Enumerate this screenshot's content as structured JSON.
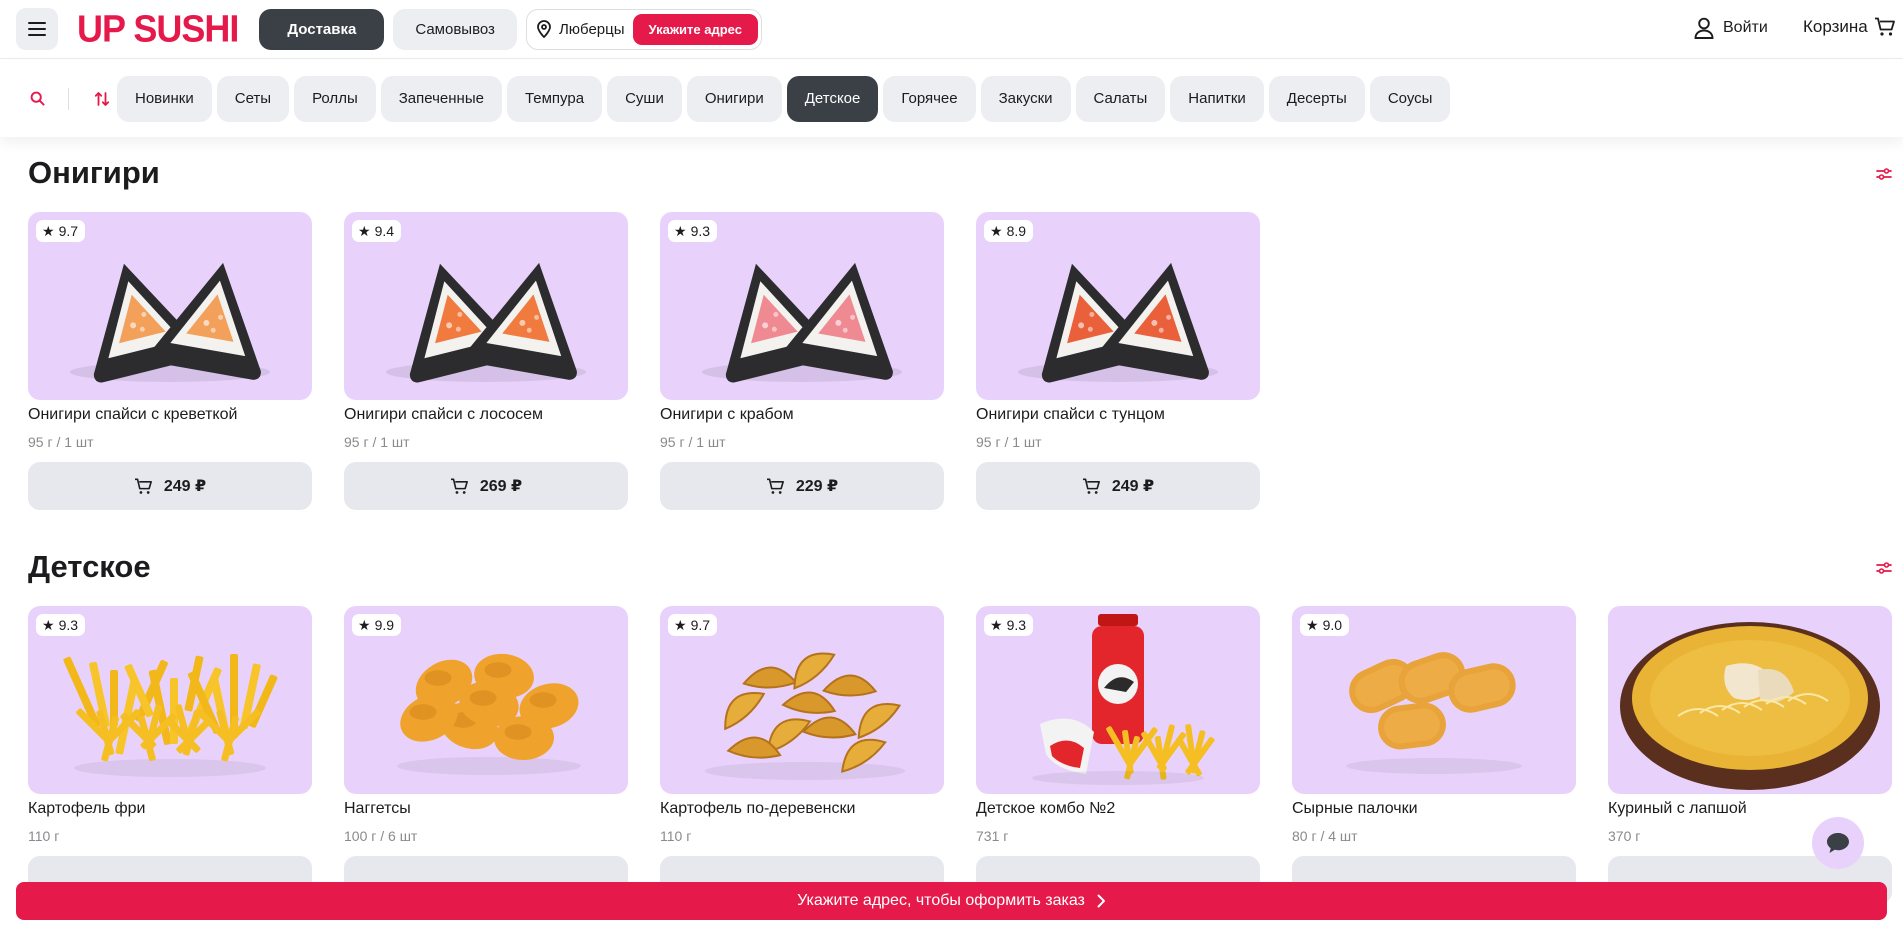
{
  "header": {
    "logo": "UP SUSHI",
    "delivery_label": "Доставка",
    "pickup_label": "Самовывоз",
    "city": "Люберцы",
    "address_button": "Укажите адрес",
    "login_label": "Войти",
    "cart_label": "Корзина"
  },
  "categories": [
    "Новинки",
    "Сеты",
    "Роллы",
    "Запеченные",
    "Темпура",
    "Суши",
    "Онигири",
    "Детское",
    "Горячее",
    "Закуски",
    "Салаты",
    "Напитки",
    "Десерты",
    "Соусы"
  ],
  "active_category": "Детское",
  "sections": [
    {
      "title": "Онигири",
      "products": [
        {
          "name": "Онигири спайси с креветкой",
          "weight": "95 г / 1 шт",
          "rating": "9.7",
          "price": "249 ₽",
          "image": "onigiri-shrimp"
        },
        {
          "name": "Онигири спайси с лососем",
          "weight": "95 г / 1 шт",
          "rating": "9.4",
          "price": "269 ₽",
          "image": "onigiri-salmon"
        },
        {
          "name": "Онигири с крабом",
          "weight": "95 г / 1 шт",
          "rating": "9.3",
          "price": "229 ₽",
          "image": "onigiri-crab"
        },
        {
          "name": "Онигири спайси с тунцом",
          "weight": "95 г / 1 шт",
          "rating": "8.9",
          "price": "249 ₽",
          "image": "onigiri-tuna"
        }
      ]
    },
    {
      "title": "Детское",
      "products": [
        {
          "name": "Картофель фри",
          "weight": "110 г",
          "rating": "9.3",
          "image": "french-fries"
        },
        {
          "name": "Наггетсы",
          "weight": "100 г / 6 шт",
          "rating": "9.9",
          "image": "nuggets"
        },
        {
          "name": "Картофель по-деревенски",
          "weight": "110 г",
          "rating": "9.7",
          "image": "potato-wedges"
        },
        {
          "name": "Детское комбо №2",
          "weight": "731 г",
          "rating": "9.3",
          "image": "kids-combo"
        },
        {
          "name": "Сырные палочки",
          "weight": "80 г / 4 шт",
          "rating": "9.0",
          "image": "cheese-sticks"
        },
        {
          "name": "Куриный с лапшой",
          "weight": "370 г",
          "rating": "",
          "image": "chicken-noodle-soup"
        }
      ]
    }
  ],
  "cta_label": "Укажите адрес, чтобы оформить заказ",
  "colors": {
    "brand": "#e5194a",
    "card_bg": "#e8d2fb",
    "dark": "#3a4046",
    "light_pill": "#eceef2"
  }
}
